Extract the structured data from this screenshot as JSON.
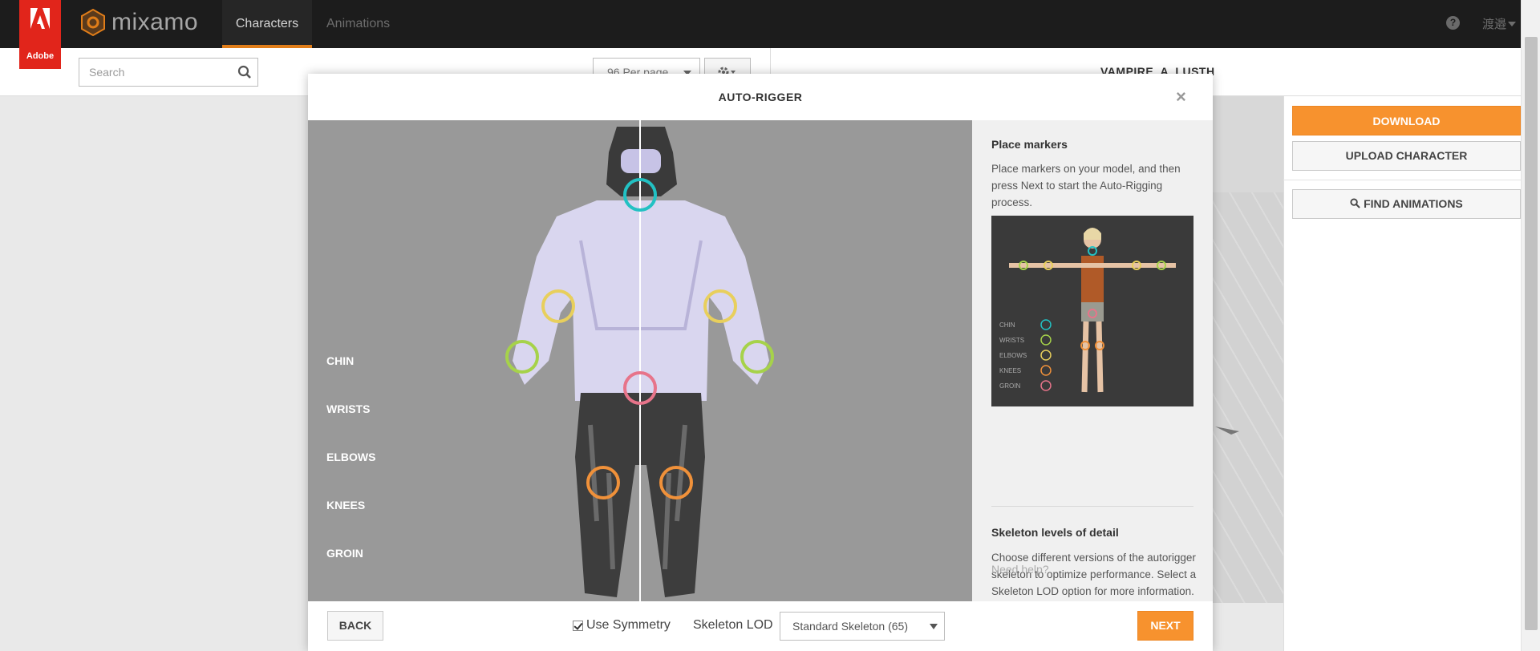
{
  "app": {
    "brand": "mixamo",
    "adobe_label": "Adobe",
    "nav": {
      "characters": "Characters",
      "animations": "Animations"
    },
    "user": "渡邉"
  },
  "toolbar": {
    "search_placeholder": "Search",
    "per_page": "96 Per page"
  },
  "character_name": "VAMPIRE_A_LUSTH",
  "right_panel": {
    "download": "DOWNLOAD",
    "upload": "UPLOAD CHARACTER",
    "find": "FIND ANIMATIONS"
  },
  "modal": {
    "title": "AUTO-RIGGER",
    "marker_labels": [
      "CHIN",
      "WRISTS",
      "ELBOWS",
      "KNEES",
      "GROIN"
    ],
    "marker_colors": {
      "chin": "#22c1c3",
      "wrists": "#a6d24a",
      "elbows": "#e8cf5c",
      "knees": "#f0913a",
      "groin": "#e7748a"
    },
    "side": {
      "place_title": "Place markers",
      "place_text": "Place markers on your model, and then press Next to start the Auto-Rigging process.",
      "guide_labels": [
        "CHIN",
        "WRISTS",
        "ELBOWS",
        "KNEES",
        "GROIN"
      ],
      "lod_title": "Skeleton levels of detail",
      "lod_text": "Choose different versions of the autorigger skeleton to optimize performance. Select a Skeleton LOD option for more information.",
      "help": "Need help?"
    },
    "footer": {
      "back": "BACK",
      "symmetry": "Use Symmetry",
      "lod_label": "Skeleton LOD",
      "lod_value": "Standard Skeleton (65)",
      "next": "NEXT"
    }
  }
}
